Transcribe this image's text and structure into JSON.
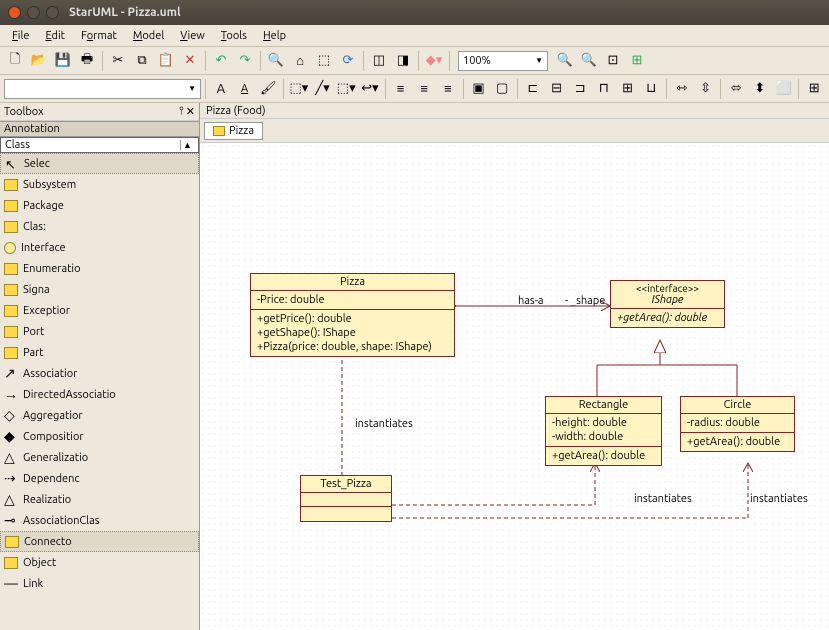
{
  "window": {
    "title": "StarUML - Pizza.uml"
  },
  "menu": {
    "file": "File",
    "edit": "Edit",
    "format": "Format",
    "model": "Model",
    "view": "View",
    "tools": "Tools",
    "help": "Help"
  },
  "toolbar": {
    "zoom": "100%"
  },
  "sidebar": {
    "title": "Toolbox",
    "sections": {
      "annotation": "Annotation",
      "class": "Class"
    },
    "items": [
      {
        "label": "Selec"
      },
      {
        "label": "Subsystem"
      },
      {
        "label": "Package"
      },
      {
        "label": "Clas:"
      },
      {
        "label": "Interface"
      },
      {
        "label": "Enumeratio"
      },
      {
        "label": "Signa"
      },
      {
        "label": "Exceptior"
      },
      {
        "label": "Port"
      },
      {
        "label": "Part"
      },
      {
        "label": "Associatior"
      },
      {
        "label": "DirectedAssociatio"
      },
      {
        "label": "Aggregatior"
      },
      {
        "label": "Compositior"
      },
      {
        "label": "Generalizatio"
      },
      {
        "label": "Dependenc"
      },
      {
        "label": "Realizatio"
      },
      {
        "label": "AssociationClas"
      },
      {
        "label": "Connecto"
      },
      {
        "label": "Object"
      },
      {
        "label": "Link"
      }
    ]
  },
  "crumb": "Pizza (Food)",
  "tab": {
    "label": "Pizza"
  },
  "diagram": {
    "pizza": {
      "name": "Pizza",
      "attrs": "-Price: double",
      "ops": "+getPrice(): double\n+getShape(): IShape\n+Pizza(price: double, shape: IShape)"
    },
    "ishape": {
      "stereo": "<<interface>>",
      "name": "IShape",
      "ops": "+getArea(): double"
    },
    "rectangle": {
      "name": "Rectangle",
      "attrs": "-height: double\n-width: double",
      "ops": "+getArea(): double"
    },
    "circle": {
      "name": "Circle",
      "attrs": "-radius: double",
      "ops": "+getArea(): double"
    },
    "test": {
      "name": "Test_Pizza"
    },
    "labels": {
      "hasa": "has-a",
      "shape": "- _shape",
      "inst": "instantiates"
    }
  }
}
